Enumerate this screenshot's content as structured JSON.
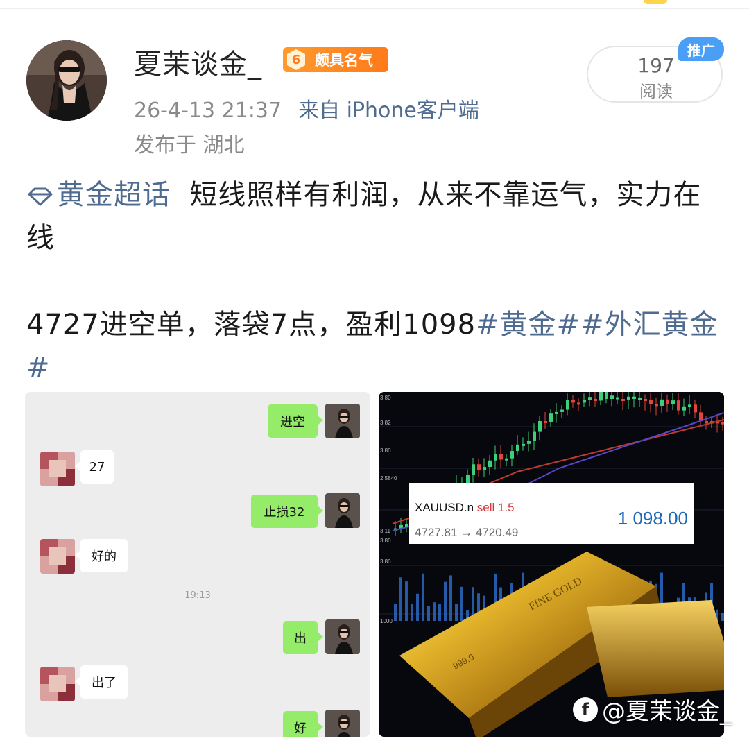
{
  "author": {
    "name": "夏茉谈金_",
    "badge_level": "6",
    "badge_label": "颇具名气",
    "post_time": "26-4-13 21:37",
    "source": "来自 iPhone客户端",
    "location": "发布于 湖北"
  },
  "stats": {
    "read_count": "197",
    "read_label": "阅读",
    "promo_tag": "推广"
  },
  "post": {
    "topic": "黄金超话",
    "line1": "短线照样有利润，从来不靠运气，实力在线",
    "line2_text": "4727进空单，落袋7点，盈利1098",
    "line2_tags": "#黄金##外汇黄金#"
  },
  "chat": {
    "messages": [
      {
        "side": "me",
        "text": "进空"
      },
      {
        "side": "them",
        "text": "27"
      },
      {
        "side": "me",
        "text": "止损32"
      },
      {
        "side": "them",
        "text": "好的"
      },
      {
        "side": "me",
        "text": "出"
      },
      {
        "side": "them",
        "text": "出了"
      },
      {
        "side": "me",
        "text": "好"
      }
    ],
    "time": "19:13"
  },
  "trade": {
    "symbol": "XAUUSD.n",
    "side": "sell 1.5",
    "prices": "4727.81 → 4720.49",
    "profit": "1 098.00"
  },
  "chart_axis_labels": [
    "3.80",
    "3.82",
    "3.80",
    "2.5840",
    "3.11",
    "3.80",
    "3.80",
    "1000"
  ],
  "watermark": "@夏茉谈金_",
  "colors": {
    "link": "#4f6b8f",
    "badge": "#ff8a24",
    "promo": "#4a9ef5",
    "bubble_me": "#95ec69",
    "profit": "#1d67b6",
    "sell": "#d9363e"
  }
}
